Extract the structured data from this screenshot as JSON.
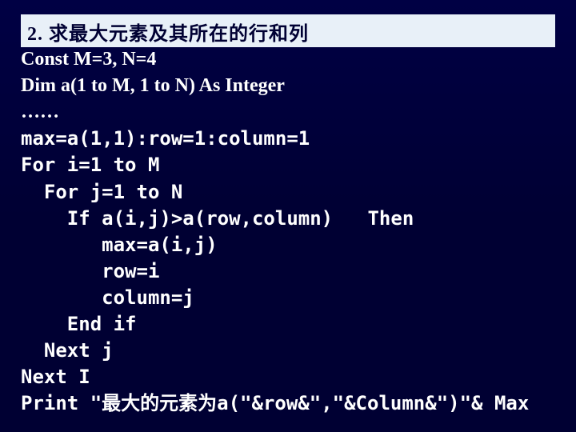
{
  "heading": "2. 求最大元素及其所在的行和列",
  "decl1": "Const M=3, N=4",
  "decl2": "Dim  a(1 to M, 1 to N) As Integer",
  "dots": "……",
  "line1": "max=a(1,1):row=1:column=1",
  "line2": "For i=1 to M",
  "line3": "  For j=1 to N",
  "line4": "    If a(i,j)>a(row,column)   Then",
  "line5": "       max=a(i,j)",
  "line6": "       row=i",
  "line7": "       column=j",
  "line8": "    End if",
  "line9": "  Next j",
  "line10": "Next I",
  "print_prefix": "Print \"",
  "print_cjk": "最大的元素为",
  "print_suffix": "a(\"&row&\",\"&Column&\")\"& Max"
}
